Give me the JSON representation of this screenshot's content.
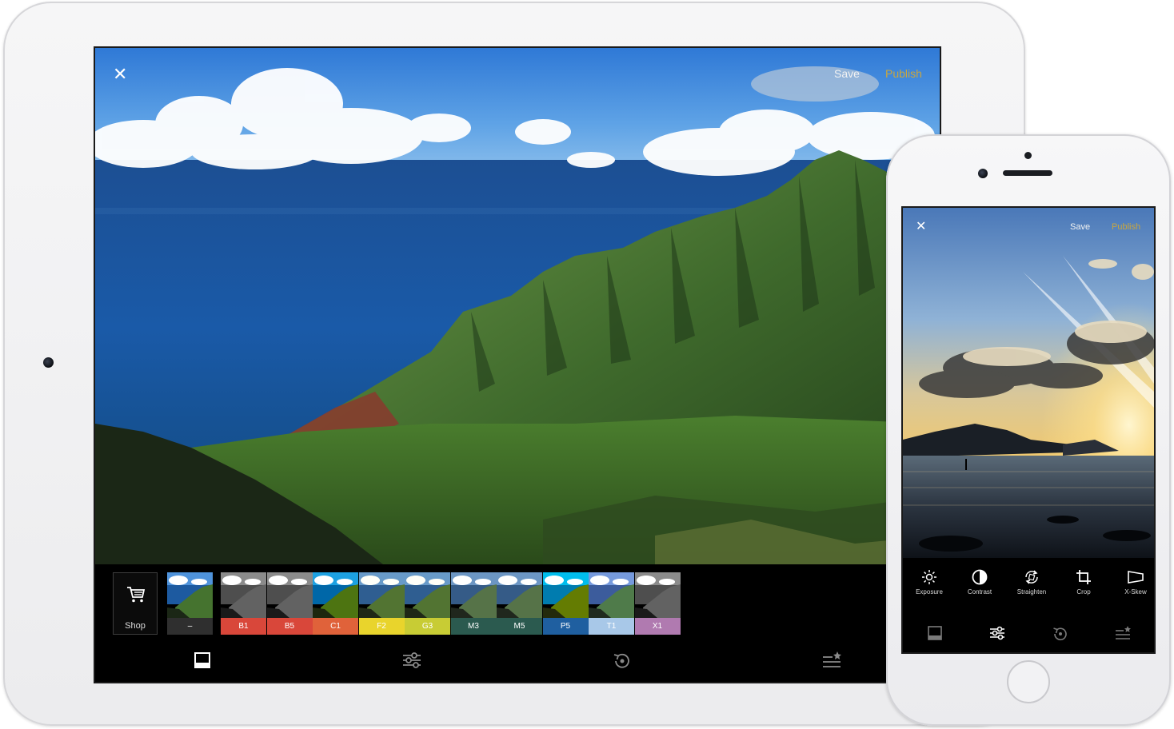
{
  "ipad": {
    "topbar": {
      "close_icon": "close-icon",
      "save_label": "Save",
      "publish_label": "Publish"
    },
    "shop": {
      "label": "Shop",
      "icon": "cart-icon"
    },
    "filters": [
      {
        "label": "–",
        "color": "#2f2f2f"
      },
      {
        "label": "B1",
        "color": "#d9473a"
      },
      {
        "label": "B5",
        "color": "#d9473a"
      },
      {
        "label": "C1",
        "color": "#e0623a"
      },
      {
        "label": "F2",
        "color": "#e9d42c"
      },
      {
        "label": "G3",
        "color": "#c8cc34"
      },
      {
        "label": "M3",
        "color": "#2b5a4f"
      },
      {
        "label": "M5",
        "color": "#2b5a4f"
      },
      {
        "label": "P5",
        "color": "#1f5fa0"
      },
      {
        "label": "T1",
        "color": "#a8c8e8"
      },
      {
        "label": "X1",
        "color": "#b07ab0"
      }
    ],
    "nav_icons": [
      "presets-icon",
      "adjust-icon",
      "history-icon",
      "recipes-icon"
    ]
  },
  "iphone": {
    "topbar": {
      "close_icon": "close-icon",
      "save_label": "Save",
      "publish_label": "Publish"
    },
    "tools": [
      {
        "label": "Exposure",
        "icon": "sun-icon"
      },
      {
        "label": "Contrast",
        "icon": "contrast-icon"
      },
      {
        "label": "Straighten",
        "icon": "rotate-icon"
      },
      {
        "label": "Crop",
        "icon": "crop-icon"
      },
      {
        "label": "X-Skew",
        "icon": "skew-icon"
      }
    ],
    "nav_icons": [
      "presets-icon",
      "adjust-icon",
      "history-icon",
      "recipes-icon"
    ]
  },
  "colors": {
    "accent_publish": "#c8a640"
  }
}
